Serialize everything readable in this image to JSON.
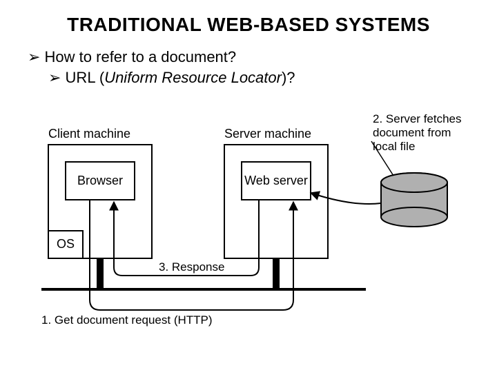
{
  "title": "TRADITIONAL WEB-BASED SYSTEMS",
  "bullets": {
    "b1": "How to refer to a document?",
    "b2_prefix": "URL (",
    "b2_italic": "Uniform Resource Locator",
    "b2_suffix": ")?"
  },
  "diagram": {
    "client_machine": "Client machine",
    "server_machine": "Server machine",
    "browser": "Browser",
    "web_server": "Web server",
    "os": "OS",
    "step1": "1. Get document request (HTTP)",
    "step2a": "2. Server fetches",
    "step2b": "document from",
    "step2c": "local file",
    "step3": "3. Response"
  }
}
